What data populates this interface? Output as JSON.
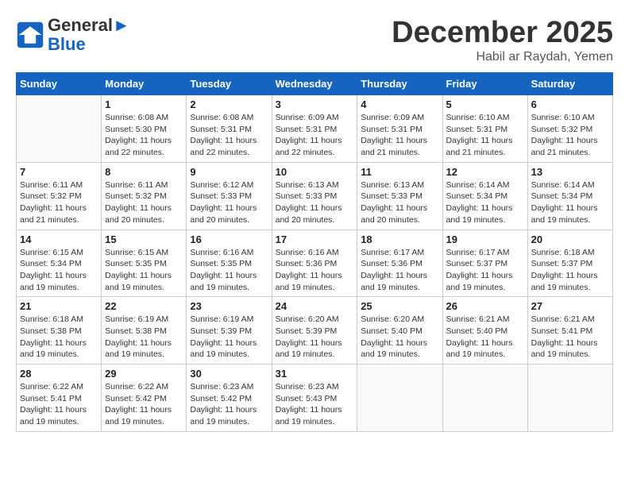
{
  "header": {
    "logo_line1": "General",
    "logo_line2": "Blue",
    "month": "December 2025",
    "location": "Habil ar Raydah, Yemen"
  },
  "columns": [
    "Sunday",
    "Monday",
    "Tuesday",
    "Wednesday",
    "Thursday",
    "Friday",
    "Saturday"
  ],
  "weeks": [
    [
      {
        "day": "",
        "info": ""
      },
      {
        "day": "1",
        "info": "Sunrise: 6:08 AM\nSunset: 5:30 PM\nDaylight: 11 hours\nand 22 minutes."
      },
      {
        "day": "2",
        "info": "Sunrise: 6:08 AM\nSunset: 5:31 PM\nDaylight: 11 hours\nand 22 minutes."
      },
      {
        "day": "3",
        "info": "Sunrise: 6:09 AM\nSunset: 5:31 PM\nDaylight: 11 hours\nand 22 minutes."
      },
      {
        "day": "4",
        "info": "Sunrise: 6:09 AM\nSunset: 5:31 PM\nDaylight: 11 hours\nand 21 minutes."
      },
      {
        "day": "5",
        "info": "Sunrise: 6:10 AM\nSunset: 5:31 PM\nDaylight: 11 hours\nand 21 minutes."
      },
      {
        "day": "6",
        "info": "Sunrise: 6:10 AM\nSunset: 5:32 PM\nDaylight: 11 hours\nand 21 minutes."
      }
    ],
    [
      {
        "day": "7",
        "info": "Sunrise: 6:11 AM\nSunset: 5:32 PM\nDaylight: 11 hours\nand 21 minutes."
      },
      {
        "day": "8",
        "info": "Sunrise: 6:11 AM\nSunset: 5:32 PM\nDaylight: 11 hours\nand 20 minutes."
      },
      {
        "day": "9",
        "info": "Sunrise: 6:12 AM\nSunset: 5:33 PM\nDaylight: 11 hours\nand 20 minutes."
      },
      {
        "day": "10",
        "info": "Sunrise: 6:13 AM\nSunset: 5:33 PM\nDaylight: 11 hours\nand 20 minutes."
      },
      {
        "day": "11",
        "info": "Sunrise: 6:13 AM\nSunset: 5:33 PM\nDaylight: 11 hours\nand 20 minutes."
      },
      {
        "day": "12",
        "info": "Sunrise: 6:14 AM\nSunset: 5:34 PM\nDaylight: 11 hours\nand 19 minutes."
      },
      {
        "day": "13",
        "info": "Sunrise: 6:14 AM\nSunset: 5:34 PM\nDaylight: 11 hours\nand 19 minutes."
      }
    ],
    [
      {
        "day": "14",
        "info": "Sunrise: 6:15 AM\nSunset: 5:34 PM\nDaylight: 11 hours\nand 19 minutes."
      },
      {
        "day": "15",
        "info": "Sunrise: 6:15 AM\nSunset: 5:35 PM\nDaylight: 11 hours\nand 19 minutes."
      },
      {
        "day": "16",
        "info": "Sunrise: 6:16 AM\nSunset: 5:35 PM\nDaylight: 11 hours\nand 19 minutes."
      },
      {
        "day": "17",
        "info": "Sunrise: 6:16 AM\nSunset: 5:36 PM\nDaylight: 11 hours\nand 19 minutes."
      },
      {
        "day": "18",
        "info": "Sunrise: 6:17 AM\nSunset: 5:36 PM\nDaylight: 11 hours\nand 19 minutes."
      },
      {
        "day": "19",
        "info": "Sunrise: 6:17 AM\nSunset: 5:37 PM\nDaylight: 11 hours\nand 19 minutes."
      },
      {
        "day": "20",
        "info": "Sunrise: 6:18 AM\nSunset: 5:37 PM\nDaylight: 11 hours\nand 19 minutes."
      }
    ],
    [
      {
        "day": "21",
        "info": "Sunrise: 6:18 AM\nSunset: 5:38 PM\nDaylight: 11 hours\nand 19 minutes."
      },
      {
        "day": "22",
        "info": "Sunrise: 6:19 AM\nSunset: 5:38 PM\nDaylight: 11 hours\nand 19 minutes."
      },
      {
        "day": "23",
        "info": "Sunrise: 6:19 AM\nSunset: 5:39 PM\nDaylight: 11 hours\nand 19 minutes."
      },
      {
        "day": "24",
        "info": "Sunrise: 6:20 AM\nSunset: 5:39 PM\nDaylight: 11 hours\nand 19 minutes."
      },
      {
        "day": "25",
        "info": "Sunrise: 6:20 AM\nSunset: 5:40 PM\nDaylight: 11 hours\nand 19 minutes."
      },
      {
        "day": "26",
        "info": "Sunrise: 6:21 AM\nSunset: 5:40 PM\nDaylight: 11 hours\nand 19 minutes."
      },
      {
        "day": "27",
        "info": "Sunrise: 6:21 AM\nSunset: 5:41 PM\nDaylight: 11 hours\nand 19 minutes."
      }
    ],
    [
      {
        "day": "28",
        "info": "Sunrise: 6:22 AM\nSunset: 5:41 PM\nDaylight: 11 hours\nand 19 minutes."
      },
      {
        "day": "29",
        "info": "Sunrise: 6:22 AM\nSunset: 5:42 PM\nDaylight: 11 hours\nand 19 minutes."
      },
      {
        "day": "30",
        "info": "Sunrise: 6:23 AM\nSunset: 5:42 PM\nDaylight: 11 hours\nand 19 minutes."
      },
      {
        "day": "31",
        "info": "Sunrise: 6:23 AM\nSunset: 5:43 PM\nDaylight: 11 hours\nand 19 minutes."
      },
      {
        "day": "",
        "info": ""
      },
      {
        "day": "",
        "info": ""
      },
      {
        "day": "",
        "info": ""
      }
    ]
  ]
}
